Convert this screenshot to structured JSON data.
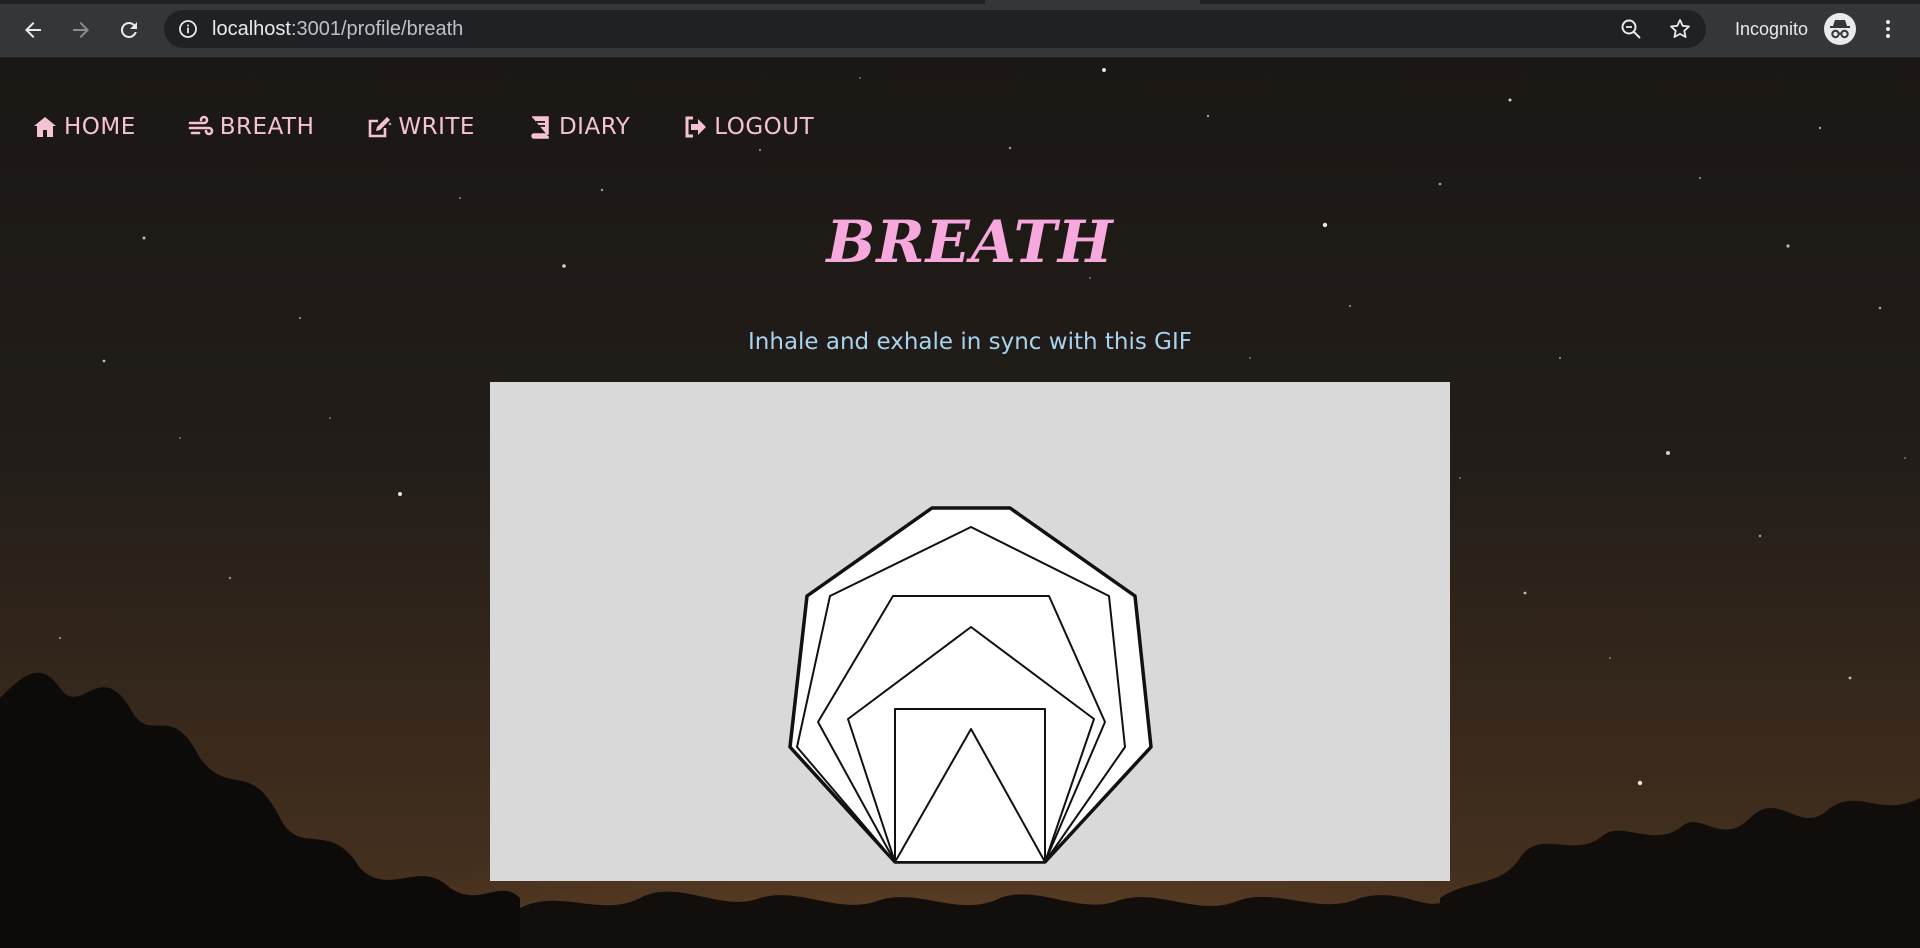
{
  "browser": {
    "url_host": "localhost",
    "url_path": ":3001/profile/breath",
    "mode_label": "Incognito",
    "icons": [
      "back-arrow-icon",
      "forward-arrow-icon",
      "reload-icon",
      "info-icon",
      "zoom-icon",
      "star-icon",
      "incognito-icon",
      "menu-icon"
    ]
  },
  "nav": {
    "items": [
      {
        "label": "HOME",
        "icon": "home-icon"
      },
      {
        "label": "BREATH",
        "icon": "wind-icon"
      },
      {
        "label": "WRITE",
        "icon": "edit-icon"
      },
      {
        "label": "DIARY",
        "icon": "book-icon"
      },
      {
        "label": "LOGOUT",
        "icon": "sign-out-icon"
      }
    ]
  },
  "main": {
    "title": "BREATH",
    "subtitle": "Inhale and exhale in sync with this GIF"
  },
  "colors": {
    "nav_text": "#f4c2d4",
    "title": "#f7a8dd",
    "subtitle": "#a9d3ec",
    "gif_background": "#d9d9d9"
  }
}
